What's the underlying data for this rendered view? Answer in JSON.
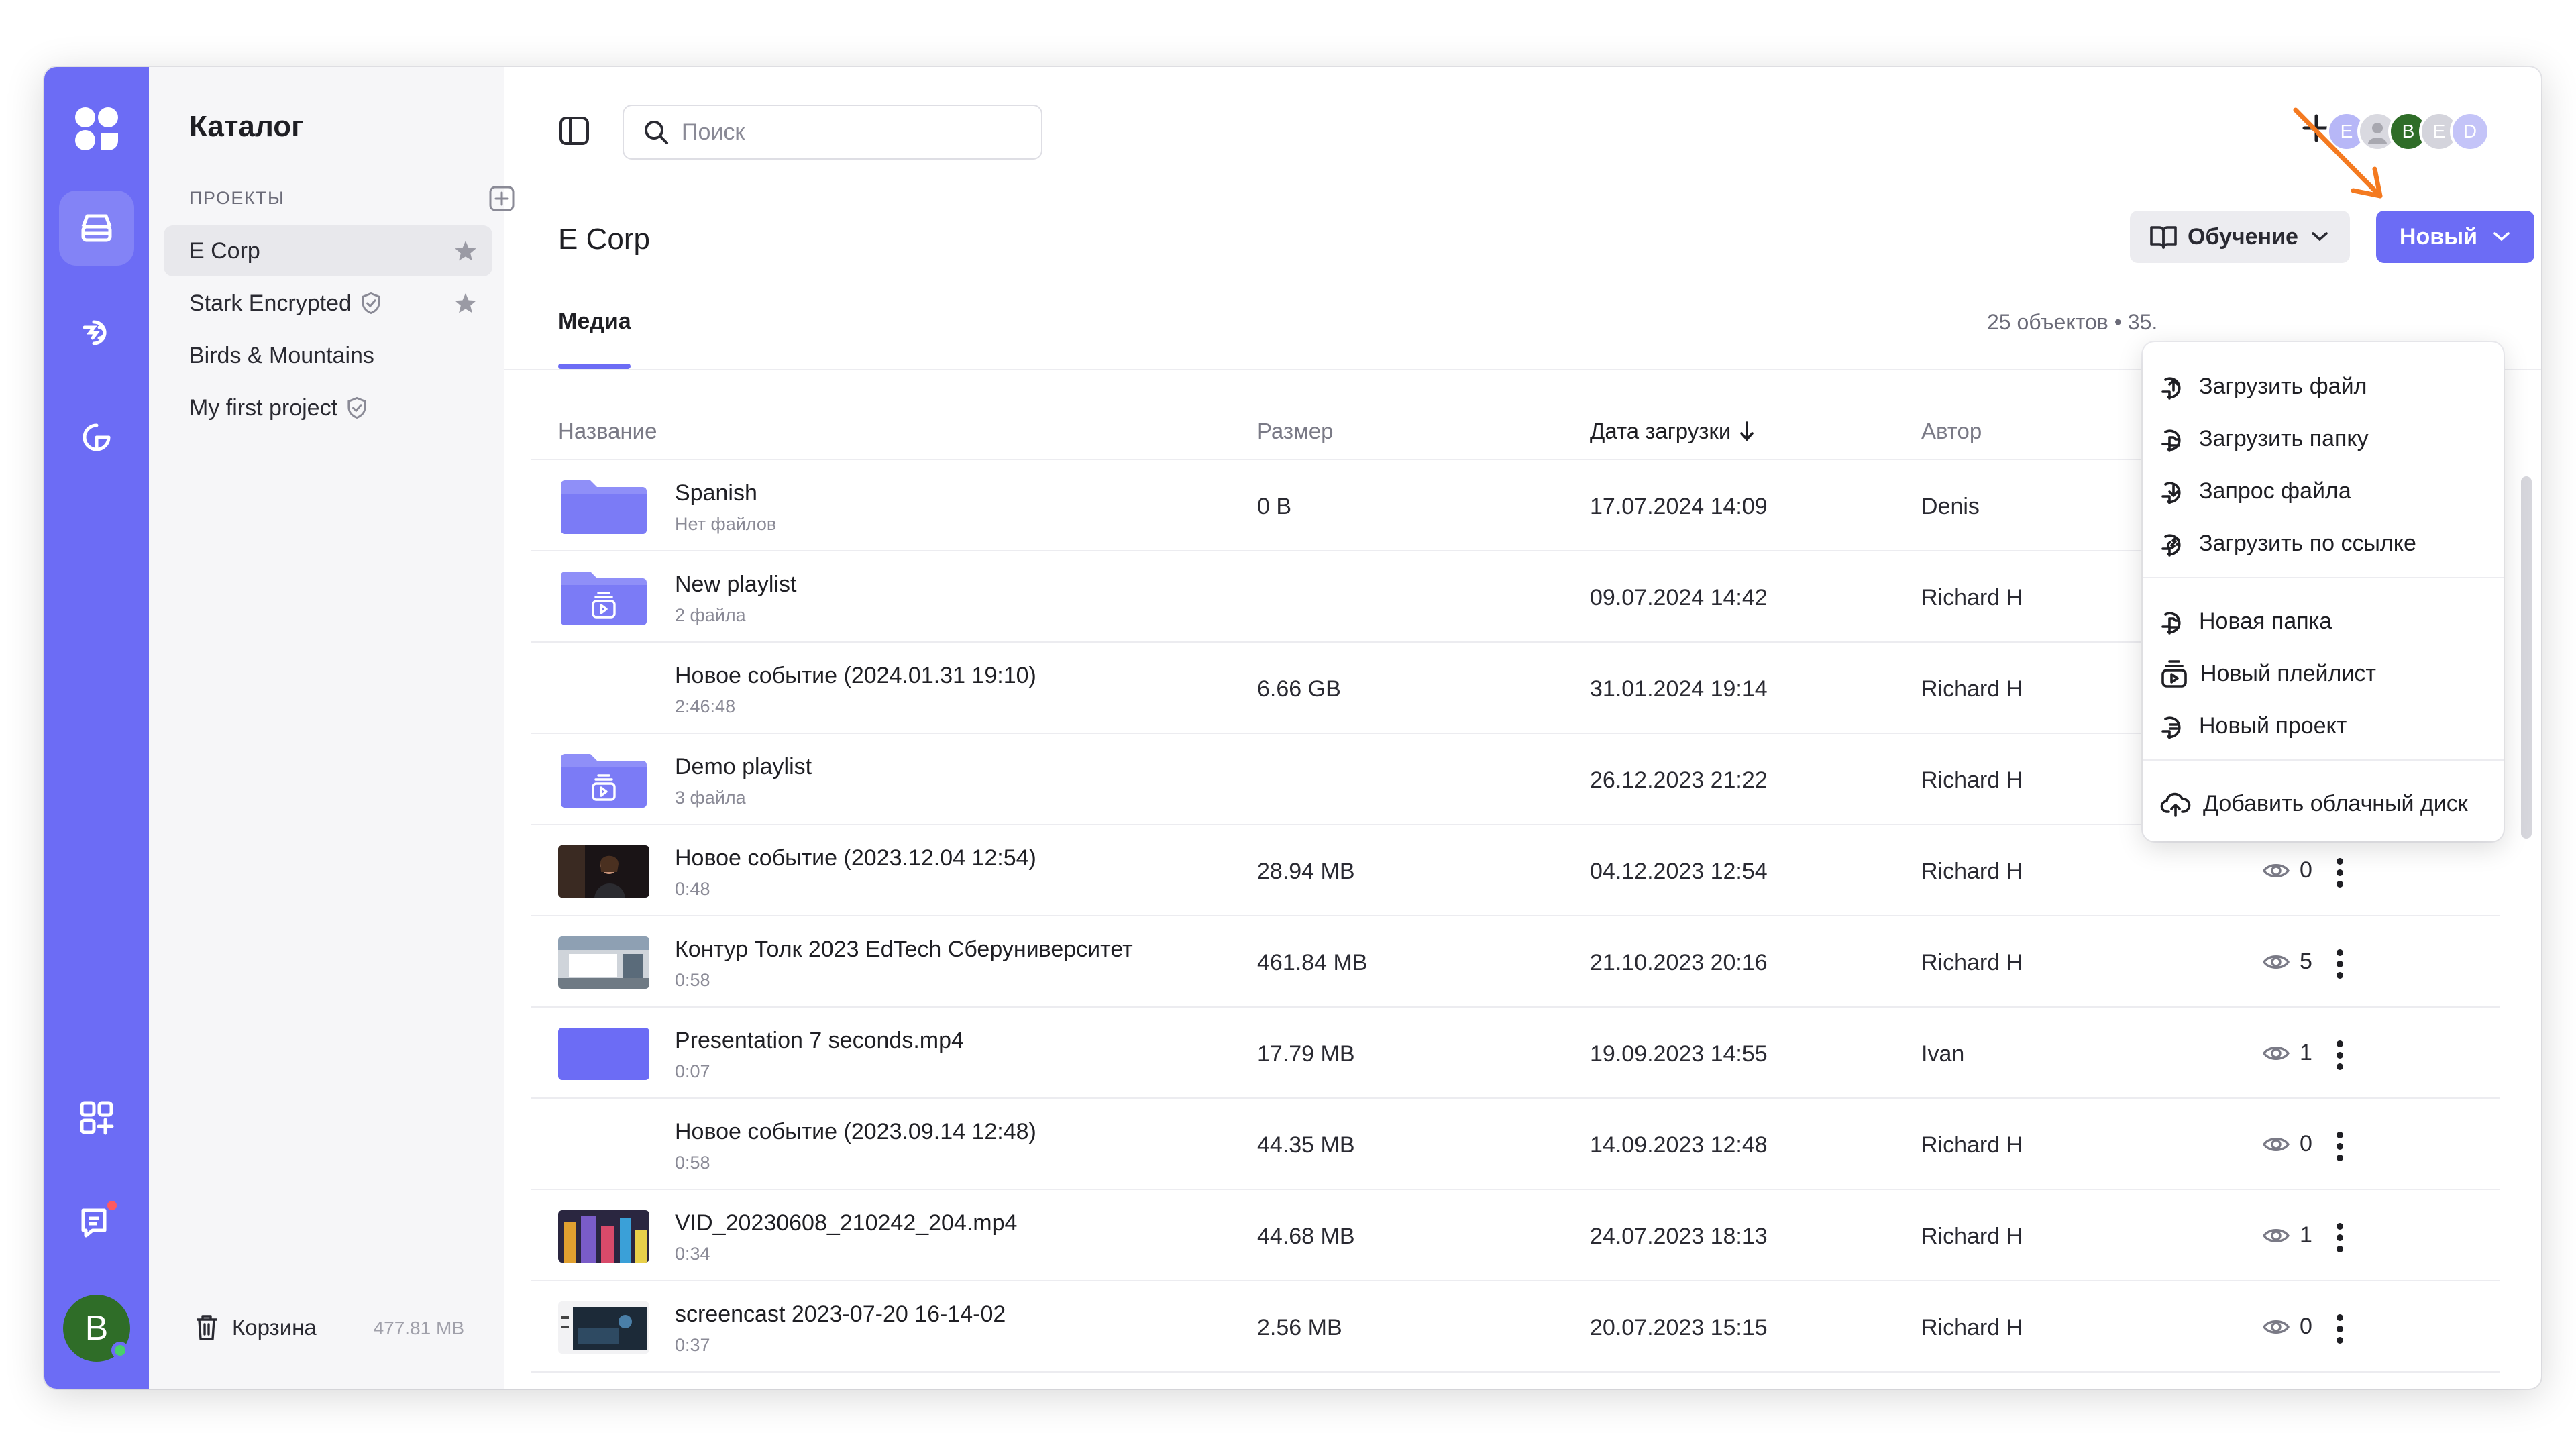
{
  "sidebar": {
    "title": "Каталог",
    "section_label": "ПРОЕКТЫ",
    "projects": [
      {
        "label": "E Corp"
      },
      {
        "label": "Stark Encrypted"
      },
      {
        "label": "Birds & Mountains"
      },
      {
        "label": "My first project"
      }
    ],
    "trash_label": "Корзина",
    "trash_size": "477.81 MB",
    "user_initial": "B"
  },
  "header": {
    "search_placeholder": "Поиск",
    "avatars": [
      "E",
      "",
      "B",
      "E",
      "D"
    ]
  },
  "page": {
    "title": "E Corp",
    "learn_label": "Обучение",
    "new_label": "Новый",
    "tab_media": "Медиа",
    "count_text": "25 объектов • 35."
  },
  "table": {
    "headers": {
      "name": "Название",
      "size": "Размер",
      "date": "Дата загрузки",
      "author": "Автор"
    },
    "rows": [
      {
        "name": "Spanish",
        "sub": "Нет файлов",
        "size": "0 B",
        "date": "17.07.2024 14:09",
        "author": "Denis",
        "views": ""
      },
      {
        "name": "New playlist",
        "sub": "2 файла",
        "size": "",
        "date": "09.07.2024 14:42",
        "author": "Richard H",
        "views": ""
      },
      {
        "name": "Новое событие (2024.01.31 19:10)",
        "sub": "2:46:48",
        "size": "6.66 GB",
        "date": "31.01.2024 19:14",
        "author": "Richard H",
        "views": ""
      },
      {
        "name": "Demo playlist",
        "sub": "3 файла",
        "size": "",
        "date": "26.12.2023 21:22",
        "author": "Richard H",
        "views": ""
      },
      {
        "name": "Новое событие (2023.12.04 12:54)",
        "sub": "0:48",
        "size": "28.94 MB",
        "date": "04.12.2023 12:54",
        "author": "Richard H",
        "views": "0"
      },
      {
        "name": "Контур Толк 2023 EdTech Сберуниверситет",
        "sub": "0:58",
        "size": "461.84 MB",
        "date": "21.10.2023 20:16",
        "author": "Richard H",
        "views": "5"
      },
      {
        "name": "Presentation 7 seconds.mp4",
        "sub": "0:07",
        "size": "17.79 MB",
        "date": "19.09.2023 14:55",
        "author": "Ivan",
        "views": "1"
      },
      {
        "name": "Новое событие (2023.09.14 12:48)",
        "sub": "0:58",
        "size": "44.35 MB",
        "date": "14.09.2023 12:48",
        "author": "Richard H",
        "views": "0"
      },
      {
        "name": "VID_20230608_210242_204.mp4",
        "sub": "0:34",
        "size": "44.68 MB",
        "date": "24.07.2023 18:13",
        "author": "Richard H",
        "views": "1"
      },
      {
        "name": "screencast 2023-07-20 16-14-02",
        "sub": "0:37",
        "size": "2.56 MB",
        "date": "20.07.2023 15:15",
        "author": "Richard H",
        "views": "0"
      }
    ]
  },
  "menu": {
    "upload_file": "Загрузить файл",
    "upload_folder": "Загрузить папку",
    "request_file": "Запрос файла",
    "upload_link": "Загрузить по ссылке",
    "new_folder": "Новая папка",
    "new_playlist": "Новый плейлист",
    "new_project": "Новый проект",
    "add_cloud": "Добавить облачный диск"
  },
  "colors": {
    "accent": "#6c6cf5",
    "annotation_arrow": "#f47a20",
    "avatar_green": "#2f6d28"
  }
}
